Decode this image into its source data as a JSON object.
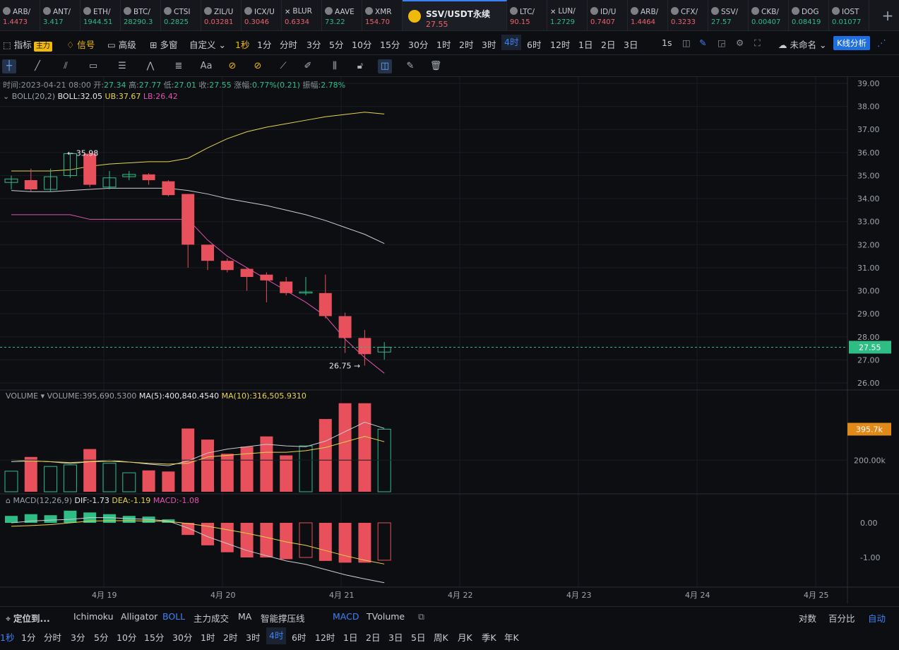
{
  "ticker": [
    {
      "name": "ARB/",
      "price": "1.4473",
      "dir": "dn"
    },
    {
      "name": "ANT/",
      "price": "3.417",
      "dir": "up"
    },
    {
      "name": "ETH/",
      "price": "1944.51",
      "dir": "up"
    },
    {
      "name": "BTC/",
      "price": "28290.3",
      "dir": "up"
    },
    {
      "name": "CTSI",
      "price": "0.2825",
      "dir": "up"
    },
    {
      "name": "ZIL/U",
      "price": "0.03281",
      "dir": "dn"
    },
    {
      "name": "ICX/U",
      "price": "0.3046",
      "dir": "dn"
    },
    {
      "name": "BLUR",
      "price": "0.6334",
      "dir": "dn"
    },
    {
      "name": "AAVE",
      "price": "73.22",
      "dir": "up"
    },
    {
      "name": "XMR",
      "price": "154.70",
      "dir": "dn"
    }
  ],
  "active_ticker": {
    "name": "SSV/USDT永续",
    "price": "27.55"
  },
  "ticker2": [
    {
      "name": "LTC/",
      "price": "90.15",
      "dir": "dn"
    },
    {
      "name": "LUN/",
      "price": "1.2729",
      "dir": "up"
    },
    {
      "name": "ID/U",
      "price": "0.7407",
      "dir": "dn"
    },
    {
      "name": "ARB/",
      "price": "1.4464",
      "dir": "dn"
    },
    {
      "name": "CFX/",
      "price": "0.3233",
      "dir": "dn"
    },
    {
      "name": "SSV/",
      "price": "27.57",
      "dir": "up"
    },
    {
      "name": "CKB/",
      "price": "0.00407",
      "dir": "up"
    },
    {
      "name": "DOG",
      "price": "0.08419",
      "dir": "up"
    },
    {
      "name": "IOST",
      "price": "0.01077",
      "dir": "up"
    }
  ],
  "toolbar": {
    "indicator": "指标",
    "main_tag": "主力",
    "signal": "信号",
    "advanced": "高级",
    "multi": "多窗",
    "custom": "自定义",
    "intervals": [
      "1秒",
      "1分",
      "分时",
      "3分",
      "5分",
      "10分",
      "15分",
      "30分",
      "1时",
      "2时",
      "3时",
      "4时",
      "6时",
      "12时",
      "1日",
      "2日",
      "3日"
    ],
    "interval_active": "4时",
    "right_interval": "1s",
    "unnamed": "未命名",
    "kline_analysis": "K线分析"
  },
  "info": {
    "time_label": "时间:",
    "time": "2023-04-21 08:00",
    "open_label": "开:",
    "open": "27.34",
    "high_label": "高:",
    "high": "27.77",
    "low_label": "低:",
    "low": "27.01",
    "close_label": "收:",
    "close": "27.55",
    "change_label": "涨幅:",
    "change": "0.77%(0.21)",
    "amp_label": "振幅:",
    "amp": "2.78%",
    "boll_name": "BOLL(20,2)",
    "boll": "BOLL:32.05",
    "ub": "UB:37.67",
    "lb": "LB:26.42",
    "volume_name": "VOLUME",
    "volume": "VOLUME:395,690.5300",
    "vma5": "MA(5):400,840.4540",
    "vma10": "MA(10):316,505.9310",
    "macd_name": "MACD(12,26,9)",
    "dif": "DIF:-1.73",
    "dea": "DEA:-1.19",
    "macd": "MACD:-1.08"
  },
  "price_marker": "27.55",
  "volume_marker": "395.7k",
  "bottom1": {
    "locate": "定位到...",
    "items": [
      "Ichimoku",
      "Alligator",
      "BOLL",
      "主力成交",
      "MA",
      "智能撑压线",
      "MACD",
      "TVolume"
    ],
    "log": "对数",
    "percent": "百分比",
    "auto": "自动"
  },
  "bottom2": {
    "intervals": [
      "1秒",
      "1分",
      "分时",
      "3分",
      "5分",
      "10分",
      "15分",
      "30分",
      "1时",
      "2时",
      "3时",
      "4时",
      "6时",
      "12时",
      "1日",
      "2日",
      "3日",
      "5日",
      "周K",
      "月K",
      "季K",
      "年K"
    ],
    "active": "4时"
  },
  "chart_data": {
    "type": "candlestick",
    "price_axis": [
      "39.00",
      "38.00",
      "37.00",
      "36.00",
      "35.00",
      "34.00",
      "33.00",
      "32.00",
      "31.00",
      "30.00",
      "29.00",
      "28.00",
      "27.00",
      "26.00"
    ],
    "price_range": [
      25.5,
      39.3
    ],
    "date_axis": [
      "4月 19",
      "4月 20",
      "4月 21",
      "4月 22",
      "4月 23",
      "4月 24",
      "4月 25"
    ],
    "max_label": "35.98",
    "min_label": "26.75",
    "candles": [
      {
        "o": 34.7,
        "h": 35.0,
        "l": 34.4,
        "c": 34.85
      },
      {
        "o": 34.8,
        "h": 35.3,
        "l": 34.3,
        "c": 34.4
      },
      {
        "o": 34.4,
        "h": 35.3,
        "l": 34.3,
        "c": 34.95
      },
      {
        "o": 35.0,
        "h": 35.98,
        "l": 34.9,
        "c": 35.95
      },
      {
        "o": 35.95,
        "h": 36.0,
        "l": 34.5,
        "c": 34.6
      },
      {
        "o": 34.5,
        "h": 35.2,
        "l": 34.4,
        "c": 34.9
      },
      {
        "o": 34.95,
        "h": 35.2,
        "l": 34.8,
        "c": 35.05
      },
      {
        "o": 35.05,
        "h": 35.1,
        "l": 34.6,
        "c": 34.8
      },
      {
        "o": 34.75,
        "h": 34.8,
        "l": 34.1,
        "c": 34.15
      },
      {
        "o": 34.2,
        "h": 34.2,
        "l": 31.0,
        "c": 32.0
      },
      {
        "o": 32.0,
        "h": 32.0,
        "l": 30.9,
        "c": 31.3
      },
      {
        "o": 31.3,
        "h": 31.4,
        "l": 30.8,
        "c": 30.9
      },
      {
        "o": 30.95,
        "h": 31.0,
        "l": 30.0,
        "c": 30.6
      },
      {
        "o": 30.7,
        "h": 30.8,
        "l": 29.5,
        "c": 30.45
      },
      {
        "o": 30.4,
        "h": 30.6,
        "l": 29.8,
        "c": 29.9
      },
      {
        "o": 29.9,
        "h": 30.6,
        "l": 29.8,
        "c": 29.95
      },
      {
        "o": 29.9,
        "h": 30.7,
        "l": 28.8,
        "c": 28.9
      },
      {
        "o": 28.9,
        "h": 29.05,
        "l": 27.3,
        "c": 27.95
      },
      {
        "o": 27.95,
        "h": 28.3,
        "l": 26.75,
        "c": 27.25
      },
      {
        "o": 27.34,
        "h": 27.77,
        "l": 27.01,
        "c": 27.55
      }
    ],
    "ub": [
      35.2,
      35.2,
      35.2,
      35.25,
      35.4,
      35.5,
      35.55,
      35.6,
      35.6,
      35.75,
      36.2,
      36.6,
      36.9,
      37.1,
      37.25,
      37.4,
      37.55,
      37.65,
      37.75,
      37.67
    ],
    "mid": [
      34.35,
      34.3,
      34.3,
      34.35,
      34.4,
      34.45,
      34.45,
      34.45,
      34.45,
      34.35,
      34.2,
      34.0,
      33.85,
      33.7,
      33.5,
      33.3,
      33.05,
      32.75,
      32.45,
      32.05
    ],
    "lb": [
      33.3,
      33.3,
      33.3,
      33.3,
      33.1,
      33.1,
      33.1,
      33.1,
      33.1,
      33.1,
      32.2,
      31.5,
      31.0,
      30.5,
      30.0,
      29.5,
      28.9,
      27.9,
      27.1,
      26.42
    ],
    "volume_axis": [
      "200.00k"
    ],
    "volume": [
      130000,
      220000,
      160000,
      170000,
      270000,
      180000,
      120000,
      135000,
      128000,
      400000,
      330000,
      240000,
      285000,
      350000,
      230000,
      290000,
      460000,
      560000,
      560000,
      395690
    ],
    "vma5": [
      190000,
      195000,
      190000,
      178000,
      190000,
      200000,
      188000,
      175000,
      165000,
      195000,
      245000,
      270000,
      285000,
      300000,
      290000,
      285000,
      320000,
      380000,
      440000,
      400840
    ],
    "vma10": [
      200000,
      195000,
      190000,
      185000,
      190000,
      192000,
      188000,
      180000,
      175000,
      180000,
      220000,
      230000,
      240000,
      250000,
      250000,
      260000,
      280000,
      315000,
      350000,
      316505
    ],
    "macd_axis": [
      "0.00",
      "-1.00"
    ],
    "macd_hist": [
      0.2,
      0.25,
      0.22,
      0.35,
      0.3,
      0.25,
      0.2,
      0.18,
      0.1,
      -0.35,
      -0.65,
      -0.85,
      -1.0,
      -1.0,
      -1.05,
      -1.0,
      -1.1,
      -1.15,
      -1.15,
      -1.08
    ],
    "dif": [
      0.0,
      0.05,
      0.08,
      0.1,
      0.15,
      0.15,
      0.12,
      0.1,
      0.05,
      -0.15,
      -0.4,
      -0.6,
      -0.8,
      -0.95,
      -1.1,
      -1.2,
      -1.35,
      -1.5,
      -1.62,
      -1.73
    ],
    "dea": [
      -0.1,
      -0.08,
      -0.05,
      0.0,
      0.05,
      0.06,
      0.06,
      0.05,
      0.04,
      -0.02,
      -0.1,
      -0.2,
      -0.3,
      -0.42,
      -0.55,
      -0.65,
      -0.8,
      -0.95,
      -1.08,
      -1.19
    ],
    "colors": {
      "up": "#2ebd85",
      "down": "#e8505b",
      "ub": "#e8d44d",
      "mid": "#c9ccd3",
      "lb": "#e052b0",
      "vma5": "#c9ccd3",
      "vma10": "#e8d44d",
      "dif": "#c9ccd3",
      "dea": "#e8d44d"
    }
  }
}
